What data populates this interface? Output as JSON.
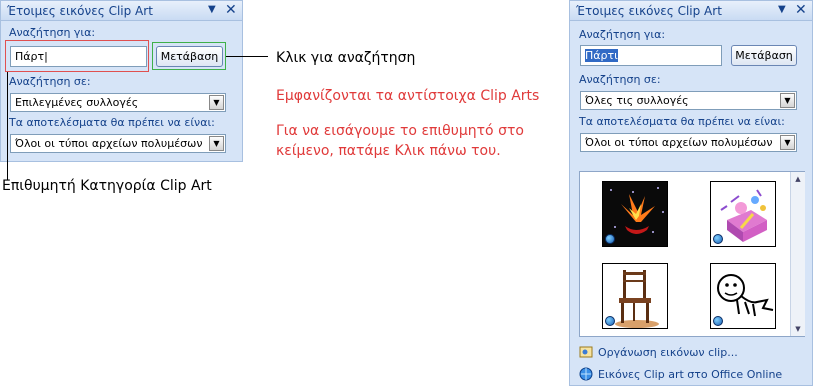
{
  "left_pane": {
    "title": "Έτοιμες εικόνες Clip Art",
    "search_label": "Αναζήτηση για:",
    "search_value": "Πάρτ|",
    "go_button": "Μετάβαση",
    "search_in_label": "Αναζήτηση σε:",
    "search_in_value": "Επιλεγμένες συλλογές",
    "results_label": "Τα αποτελέσματα θα πρέπει να είναι:",
    "results_value": "Όλοι οι τύποι αρχείων πολυμέσων"
  },
  "right_pane": {
    "title": "Έτοιμες εικόνες Clip Art",
    "search_label": "Αναζήτηση για:",
    "search_value": "Πάρτι",
    "go_button": "Μετάβαση",
    "search_in_label": "Αναζήτηση σε:",
    "search_in_value": "Όλες τις συλλογές",
    "results_label": "Τα αποτελέσματα θα πρέπει να είναι:",
    "results_value": "Όλοι οι τύποι αρχείων πολυμέσων",
    "link_organize": "Οργάνωση εικόνων clip...",
    "link_online": "Εικόνες Clip art στο Office Online"
  },
  "annotations": {
    "click_search": "Κλικ για αναζήτηση",
    "clip_arts_shown": "Εμφανίζονται τα αντίστοιχα Clip Arts",
    "insert_line1": "Για να εισάγουμε το επιθυμητό στο",
    "insert_line2": "κείμενο, πατάμε Κλικ πάνω του.",
    "category": "Επιθυμητή Κατηγορία Clip Art"
  },
  "colors": {
    "pane_bg": "#d6e4f7",
    "pane_text": "#15428b",
    "annotation_red": "#e03a3a",
    "highlight_green": "#3fb04a"
  }
}
